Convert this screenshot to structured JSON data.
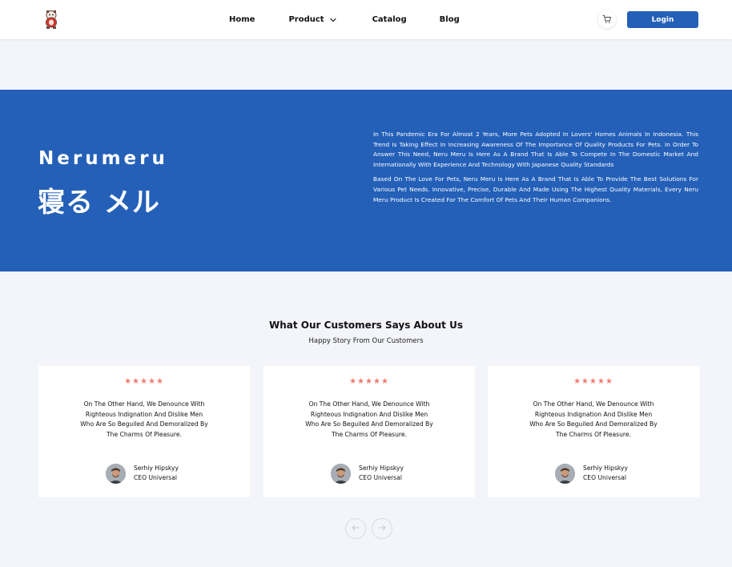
{
  "nav": {
    "links": [
      "Home",
      "Product",
      "Catalog",
      "Blog"
    ],
    "login_label": "Login",
    "accent": "#2460b8"
  },
  "hero": {
    "brand_latin": "Nerumeru",
    "brand_jp": "寝る メル",
    "paragraph1": "In This Pandemic Era For Almost 2 Years, More Pets Adopted In Lovers' Homes Animals In Indonesia. This Trend Is Taking Effect In Increasing Awareness Of The Importance Of Quality Products For Pets. In Order To Answer This Need, Neru Meru Is Here As A Brand That Is Able To Compete In The Domestic Market And Internationally With Experience And Technology With Japanese Quality Standards",
    "paragraph2": "Based On The Love For Pets, Neru Meru Is Here As A Brand That Is Able To Provide The Best Solutions For Various Pet Needs. Innovative, Precise, Durable And Made Using The Highest Quality Materials, Every Neru Meru Product Is Created For The Comfort Of Pets And Their Human Companions."
  },
  "testimonials": {
    "title": "What Our Customers Says About Us",
    "subtitle": "Happy Story From Our Customers",
    "cards": [
      {
        "stars": "★★★★★",
        "rating": 5,
        "quote": "On The Other Hand, We Denounce With Righteous Indignation And Dislike Men Who Are So Beguiled And Demoralized By The Charms Of Pleasure.",
        "name": "Serhiy Hipskyy",
        "role": "CEO Universal"
      },
      {
        "stars": "★★★★★",
        "rating": 5,
        "quote": "On The Other Hand, We Denounce With Righteous Indignation And Dislike Men Who Are So Beguiled And Demoralized By The Charms Of Pleasure.",
        "name": "Serhiy Hipskyy",
        "role": "CEO Universal"
      },
      {
        "stars": "★★★★★",
        "rating": 5,
        "quote": "On The Other Hand, We Denounce With Righteous Indignation And Dislike Men Who Are So Beguiled And Demoralized By The Charms Of Pleasure.",
        "name": "Serhiy Hipskyy",
        "role": "CEO Universal"
      }
    ],
    "star_color": "#f07c6e"
  },
  "icons": {
    "logo": "mascot-logo-icon",
    "cart": "cart-icon",
    "chevron": "chevron-down-icon",
    "prev": "arrow-left-icon",
    "next": "arrow-right-icon"
  }
}
